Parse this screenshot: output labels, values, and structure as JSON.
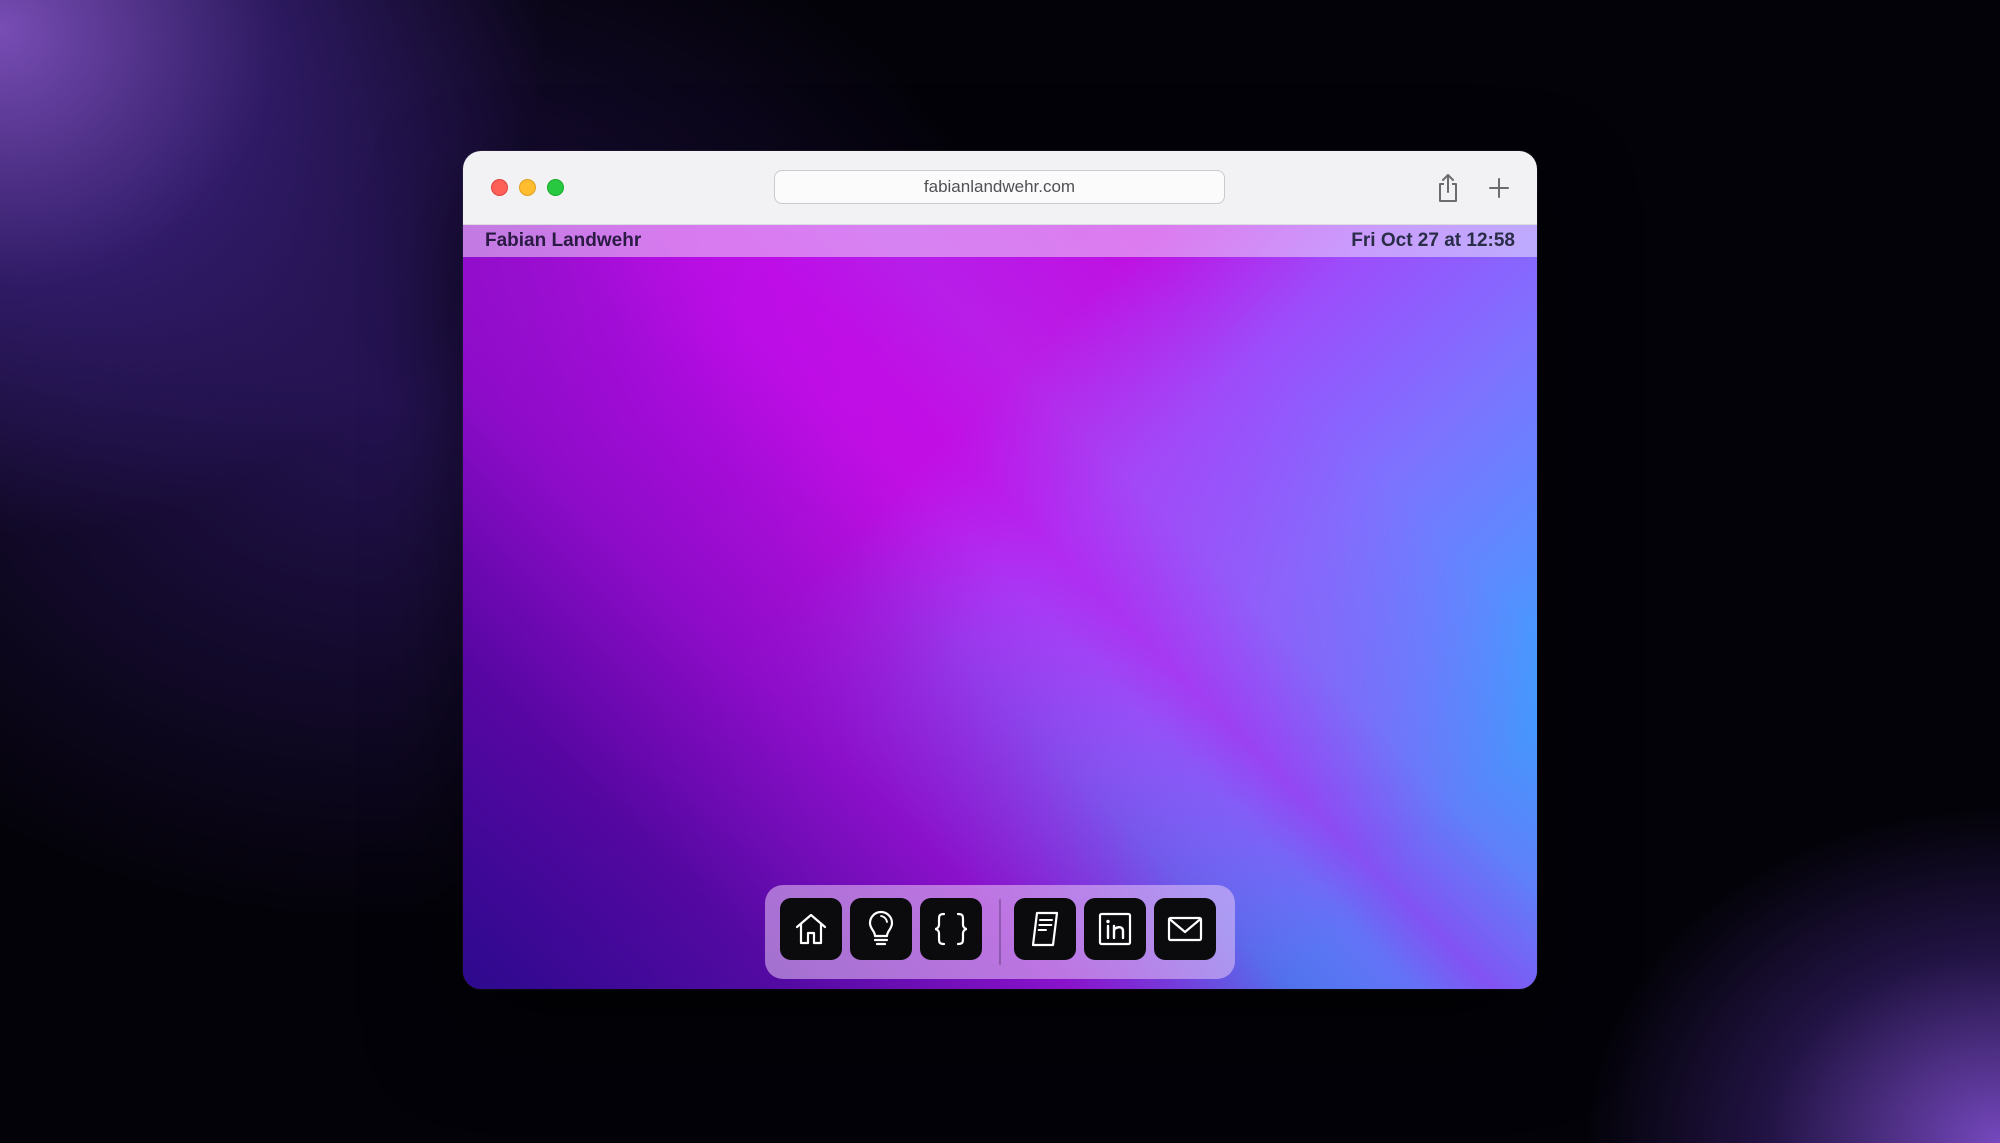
{
  "browser": {
    "url": "fabianlandwehr.com",
    "traffic_lights": {
      "close": "#fe5f57",
      "minimize": "#febc2e",
      "zoom": "#28c840"
    },
    "toolbar_icons": [
      "share-icon",
      "plus-icon"
    ]
  },
  "page": {
    "menubar": {
      "brand": "Fabian Landwehr",
      "datetime": "Fri Oct 27 at 12:58"
    },
    "dock": {
      "items": [
        {
          "icon": "home-icon"
        },
        {
          "icon": "lightbulb-icon"
        },
        {
          "icon": "curly-braces-icon"
        },
        {
          "icon": "document-icon"
        },
        {
          "icon": "linkedin-icon"
        },
        {
          "icon": "mail-icon"
        }
      ]
    },
    "colors": {
      "gradient_magenta": "#bf0fe2",
      "gradient_blue": "#33a6ff",
      "gradient_indigo": "#2d0a8e"
    }
  }
}
